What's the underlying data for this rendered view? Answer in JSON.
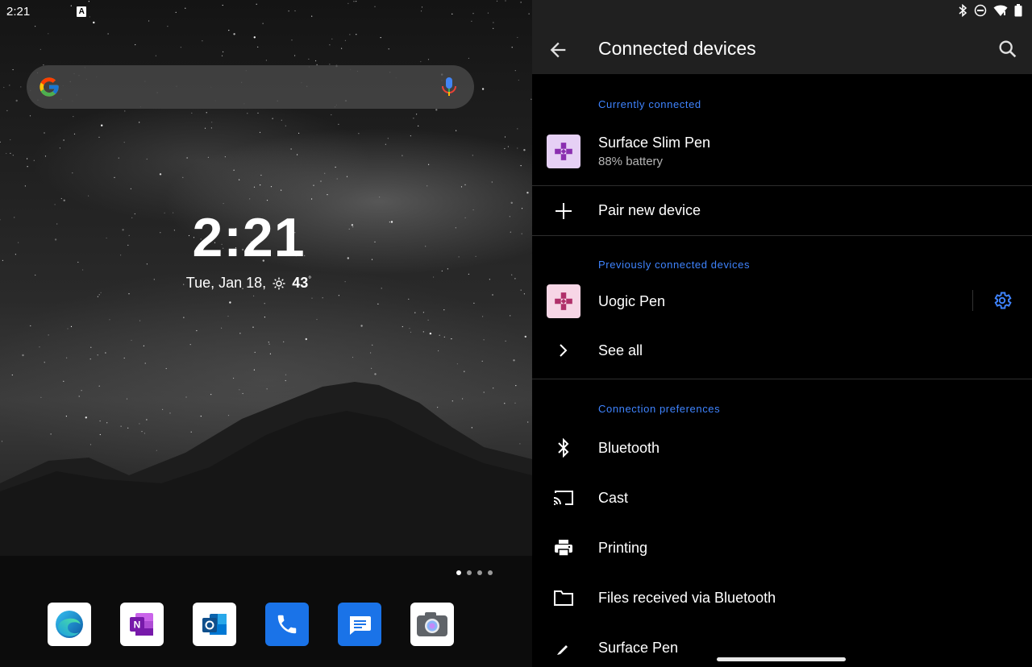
{
  "launcher": {
    "status_time": "2:21",
    "status_badge": "A",
    "clock": "2:21",
    "date": "Tue, Jan 18,",
    "temperature": "43",
    "temperature_unit": "°",
    "page_indicator": {
      "count": 4,
      "active_index": 0
    },
    "dock": [
      {
        "name": "edge-app",
        "icon": "edge-icon",
        "bg": "#ffffff"
      },
      {
        "name": "onenote-app",
        "icon": "onenote-icon",
        "bg": "#ffffff"
      },
      {
        "name": "outlook-app",
        "icon": "outlook-icon",
        "bg": "#ffffff"
      },
      {
        "name": "phone-app",
        "icon": "phone-icon",
        "bg": "#1a73e8"
      },
      {
        "name": "messages-app",
        "icon": "messages-icon",
        "bg": "#1a73e8"
      },
      {
        "name": "camera-app",
        "icon": "camera-icon",
        "bg": "#ffffff"
      }
    ]
  },
  "settings": {
    "title": "Connected devices",
    "accent": "#3f84ff",
    "sections": {
      "current": "Currently connected",
      "previous": "Previously connected devices",
      "prefs": "Connection preferences"
    },
    "current_device": {
      "name": "Surface Slim Pen",
      "status": "88% battery",
      "tile_color": "#e6d0f5"
    },
    "pair_new": "Pair new device",
    "previous_device": {
      "name": "Uogic Pen",
      "tile_color": "#f7d6e6"
    },
    "see_all": "See all",
    "preferences": [
      {
        "label": "Bluetooth",
        "icon": "bluetooth-icon"
      },
      {
        "label": "Cast",
        "icon": "cast-icon"
      },
      {
        "label": "Printing",
        "icon": "printer-icon"
      },
      {
        "label": "Files received via Bluetooth",
        "icon": "folder-icon"
      },
      {
        "label": "Surface Pen",
        "icon": "pen-icon"
      }
    ]
  }
}
